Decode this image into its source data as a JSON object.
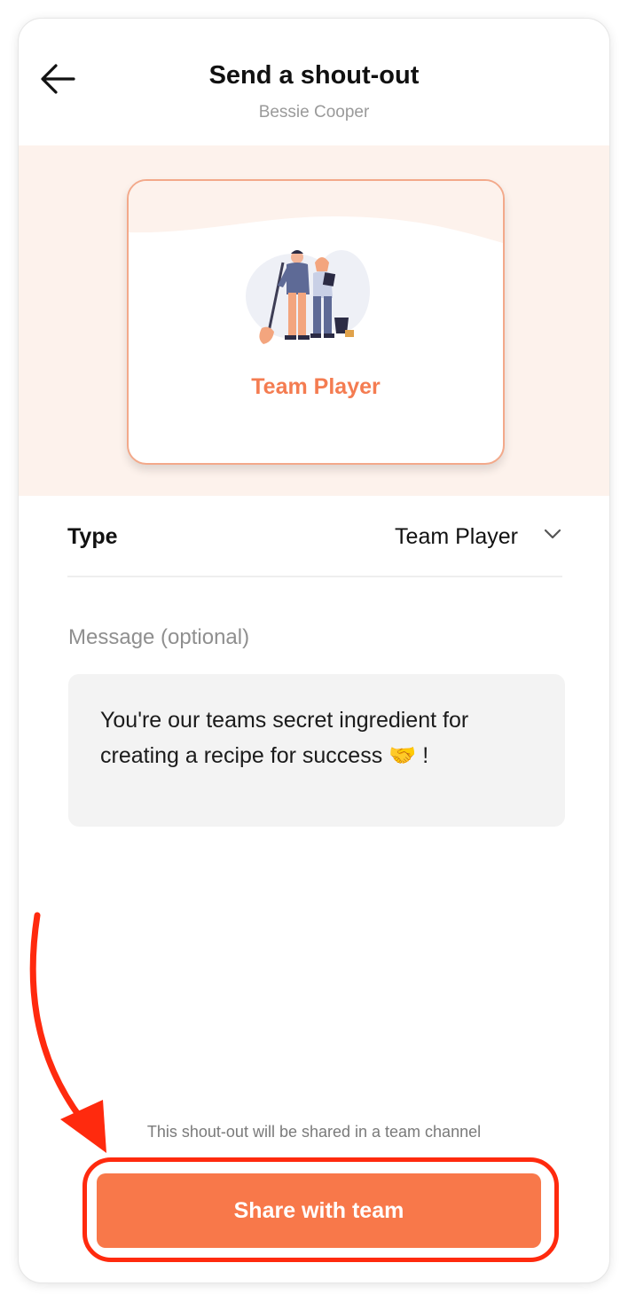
{
  "header": {
    "title": "Send a shout-out",
    "subtitle": "Bessie Cooper",
    "back_icon": "arrow-left-icon"
  },
  "card": {
    "title": "Team Player",
    "illustration": "team-player-illustration",
    "accent_color": "#f47c51",
    "background_color": "#fdf2ec"
  },
  "form": {
    "type_label": "Type",
    "type_value": "Team Player",
    "type_icon": "chevron-down-icon",
    "message_label": "Message (optional)",
    "message_value": "You're our teams secret ingredient for creating a recipe for success 🤝 !"
  },
  "footer": {
    "note": "This shout-out will be shared in a team channel",
    "share_label": "Share with team",
    "button_color": "#f8784a"
  },
  "annotation": {
    "color": "#ff2a0e"
  }
}
